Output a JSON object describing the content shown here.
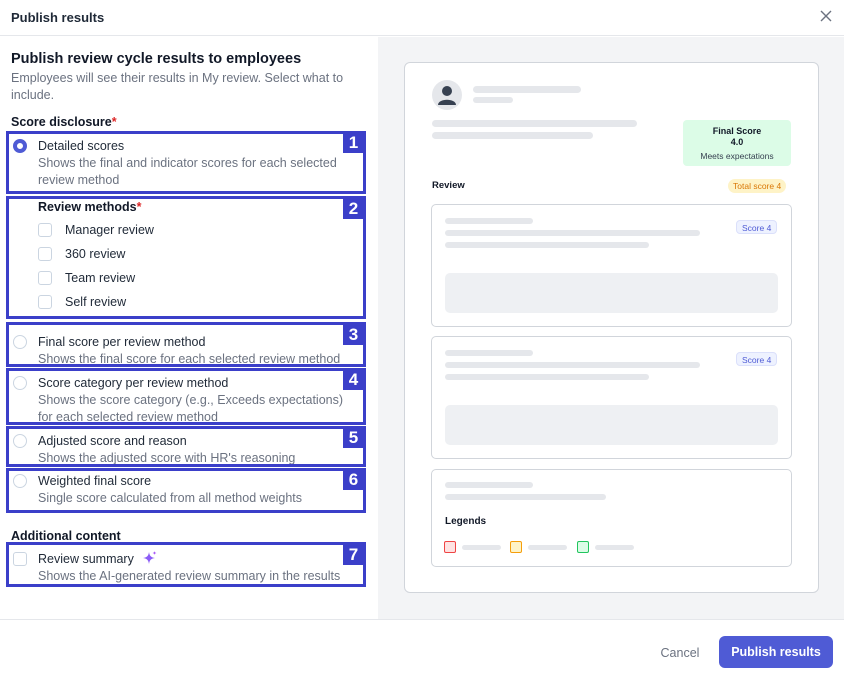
{
  "dialog": {
    "title": "Publish results",
    "close_icon": "close-icon"
  },
  "main": {
    "title": "Publish review cycle results to employees",
    "subtitle": "Employees will see their results in My review. Select what to include."
  },
  "score_disclosure": {
    "label": "Score disclosure",
    "required_mark": "*",
    "options": [
      {
        "title": "Detailed scores",
        "desc": "Shows the final and indicator scores for each selected review method",
        "selected": true
      },
      {
        "title": "Final score per review method",
        "desc": "Shows the final score for each selected review method",
        "selected": false
      },
      {
        "title": "Score category per review method",
        "desc": "Shows the score category (e.g., Exceeds expectations) for each selected review method",
        "selected": false
      },
      {
        "title": "Adjusted score and reason",
        "desc": "Shows the adjusted score with HR's reasoning",
        "selected": false
      },
      {
        "title": "Weighted final score",
        "desc": "Single score calculated from all method weights",
        "selected": false
      }
    ]
  },
  "review_methods": {
    "label": "Review methods",
    "required_mark": "*",
    "items": [
      {
        "label": "Manager review",
        "checked": false
      },
      {
        "label": "360 review",
        "checked": false
      },
      {
        "label": "Team review",
        "checked": false
      },
      {
        "label": "Self review",
        "checked": false
      }
    ]
  },
  "additional": {
    "label": "Additional content",
    "items": [
      {
        "title": "Review summary",
        "desc": "Shows the AI-generated review summary in the results",
        "checked": false,
        "icon": "sparkle-icon"
      }
    ]
  },
  "annotations": [
    "1",
    "2",
    "3",
    "4",
    "5",
    "6",
    "7"
  ],
  "preview": {
    "final_score_label": "Final Score",
    "final_score_value": "4.0",
    "final_score_category": "Meets expectations",
    "review_label": "Review",
    "total_score": "Total score 4",
    "sections": [
      {
        "score": "Score 4"
      },
      {
        "score": "Score 4"
      }
    ],
    "legends_label": "Legends",
    "legend_colors": [
      "#ef4444",
      "#f59e0b",
      "#22c55e"
    ]
  },
  "footer": {
    "cancel_label": "Cancel",
    "publish_label": "Publish results"
  },
  "colors": {
    "accent": "#4f5bd5",
    "annotation": "#3b3fc9",
    "required": "#dc2626"
  }
}
